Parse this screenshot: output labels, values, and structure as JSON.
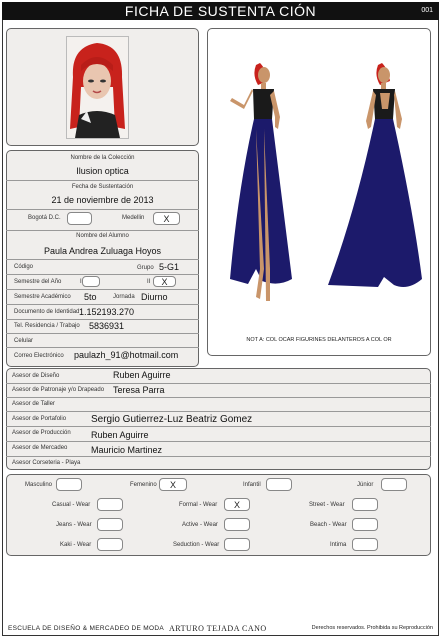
{
  "header": {
    "title": "FICHA DE SUSTENTA CIÓN",
    "number": "001"
  },
  "illustration": {
    "note": "NOT A: COL OCAR FIGURINES DELANTEROS A COL      OR"
  },
  "form": {
    "coleccion_label": "Nombre de la Colección",
    "coleccion_value": "Ilusion optica",
    "fecha_label": "Fecha de Sustentación",
    "fecha_value": "21 de noviembre de 2013",
    "bogota_label": "Bogotá D.C.",
    "bogota_value": "",
    "medellin_label": "Medellin",
    "medellin_value": "X",
    "alumno_label": "Nombre del Alumno",
    "alumno_value": "Paula Andrea Zuluaga Hoyos",
    "codigo_label": "Código",
    "codigo_value": "",
    "grupo_label": "Grupo",
    "grupo_value": "5-G1",
    "semestre_anio_label": "Semestre del Año",
    "semestre_i_label": "I",
    "semestre_i_value": "",
    "semestre_ii_label": "II",
    "semestre_ii_value": "X",
    "semestre_acad_label": "Semestre Académico",
    "semestre_acad_value": "5to",
    "jornada_label": "Jornada",
    "jornada_value": "Diurno",
    "documento_label": "Documento de Identidad",
    "documento_value": "1.152193.270",
    "tel_label": "Tel. Residencia / Trabajo",
    "tel_value": "5836931",
    "celular_label": "Celular",
    "celular_value": "",
    "correo_label": "Correo Electrónico",
    "correo_value": "paulazh_91@hotmail.com"
  },
  "advisors": [
    {
      "label": "Asesor de Diseño",
      "value": "Ruben Aguirre"
    },
    {
      "label": "Asesor de Patronaje y/o Drapeado",
      "value": "Teresa Parra"
    },
    {
      "label": "Asesor de Taller",
      "value": ""
    },
    {
      "label": "Asesor de Portafolio",
      "value": "Sergio Gutierrez-Luz Beatriz Gomez"
    },
    {
      "label": "Asesor de Producción",
      "value": "Ruben Aguirre"
    },
    {
      "label": "Asesor de Mercadeo",
      "value": "Mauricio Martinez"
    },
    {
      "label": "Asesor Corseteria - Playa",
      "value": ""
    }
  ],
  "categories": {
    "masculino": {
      "label": "Masculino",
      "value": ""
    },
    "femenino": {
      "label": "Femenino",
      "value": "X"
    },
    "infantil": {
      "label": "Infantil",
      "value": ""
    },
    "junior": {
      "label": "Júnior",
      "value": ""
    },
    "casual": {
      "label": "Casual - Wear",
      "value": ""
    },
    "formal": {
      "label": "Formal - Wear",
      "value": "X"
    },
    "street": {
      "label": "Street - Wear",
      "value": ""
    },
    "jeans": {
      "label": "Jeans - Wear",
      "value": ""
    },
    "active": {
      "label": "Active - Wear",
      "value": ""
    },
    "beach": {
      "label": "Beach - Wear",
      "value": ""
    },
    "kaki": {
      "label": "Kaki - Wear",
      "value": ""
    },
    "seduction": {
      "label": "Seduction - Wear",
      "value": ""
    },
    "intima": {
      "label": "Intima",
      "value": ""
    }
  },
  "footer": {
    "school": "ESCUELA DE DISEÑO & MERCADEO DE MODA",
    "founder": "ARTURO TEJADA CANO",
    "rights": "Derechos reservados. Prohibida su Reproducción"
  },
  "colors": {
    "dress": "#1c1a6b",
    "hair": "#c8221c",
    "skin": "#c9956a",
    "panel": "#f0eeec"
  }
}
